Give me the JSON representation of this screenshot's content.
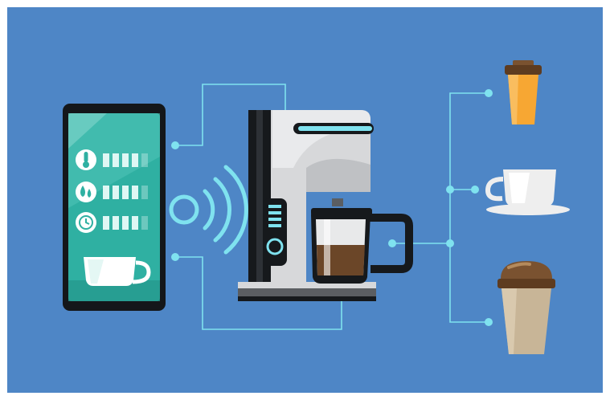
{
  "colors": {
    "background": "#4e86c6",
    "line": "#7fe2ef",
    "phone_frame": "#14171a",
    "phone_screen": "#2fb0a2",
    "machine_body": "#d7d8da",
    "machine_dark": "#16191c",
    "coffee": "#6b4628",
    "cup_orange": "#f7a733",
    "cup_white": "#eeeeee",
    "cup_beige": "#c8b597",
    "lid_brown": "#7a5230"
  },
  "icons": {
    "phone": "smartphone-icon",
    "thermometer": "thermometer-icon",
    "water_drops": "water-drop-icon",
    "clock": "clock-icon",
    "cup": "coffee-cup-icon",
    "wifi": "wireless-signal-icon",
    "coffee_machine": "coffee-machine-icon",
    "takeaway_cup": "takeaway-cup-icon",
    "espresso_cup": "espresso-cup-icon",
    "latte_cup": "latte-cup-icon"
  },
  "phone_status_levels": {
    "temperature": 0.75,
    "water": 0.75,
    "timer": 0.75
  }
}
